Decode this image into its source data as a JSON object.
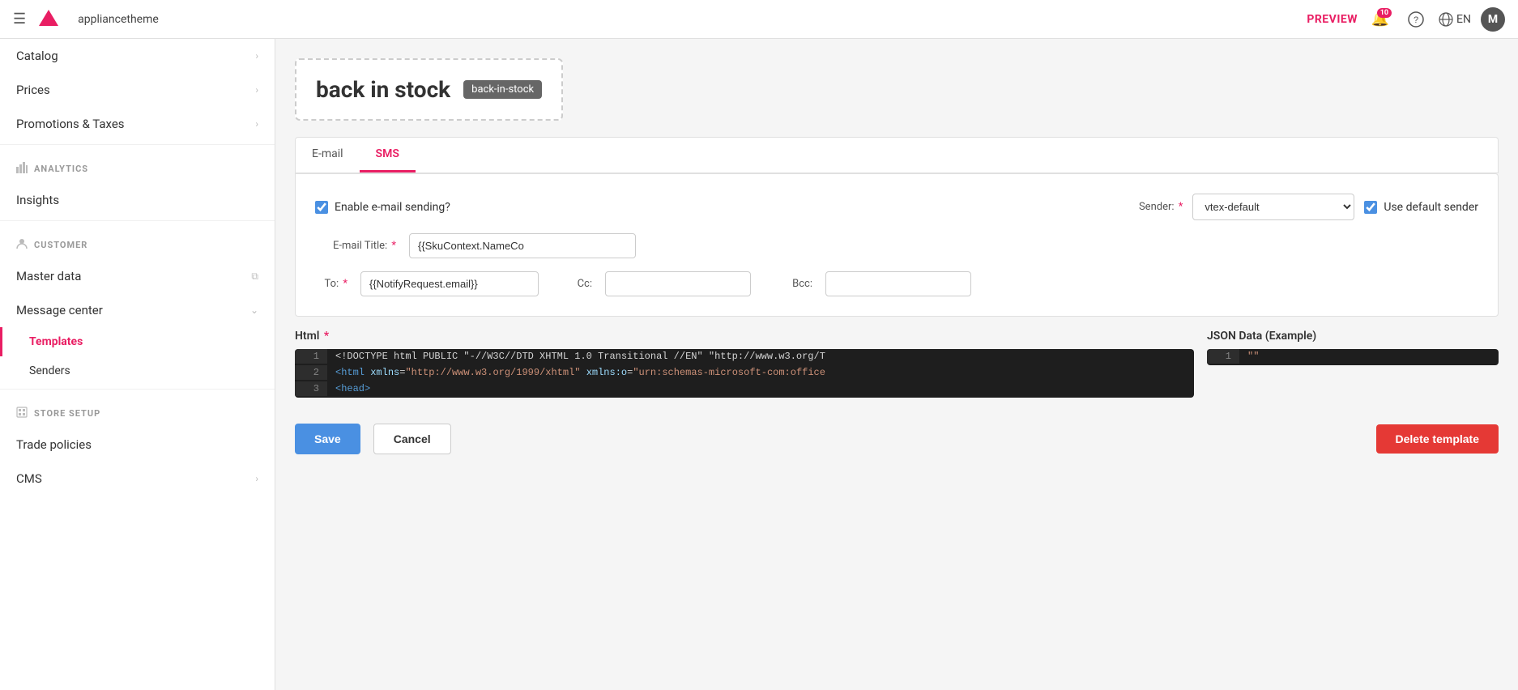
{
  "topbar": {
    "hamburger_icon": "☰",
    "logo_text": "▼",
    "app_name": "appliancetheme",
    "preview_label": "PREVIEW",
    "notifications_count": "10",
    "help_icon": "?",
    "globe_icon": "🌐",
    "lang": "EN",
    "avatar": "M"
  },
  "sidebar": {
    "catalog_label": "Catalog",
    "prices_label": "Prices",
    "promotions_taxes_label": "Promotions & Taxes",
    "analytics_label": "ANALYTICS",
    "insights_label": "Insights",
    "customer_label": "CUSTOMER",
    "master_data_label": "Master data",
    "message_center_label": "Message center",
    "templates_label": "Templates",
    "senders_label": "Senders",
    "store_setup_label": "STORE SETUP",
    "trade_policies_label": "Trade policies",
    "cms_label": "CMS"
  },
  "page": {
    "template_title": "back in stock",
    "template_slug": "back-in-stock",
    "tabs": [
      {
        "id": "email",
        "label": "E-mail"
      },
      {
        "id": "sms",
        "label": "SMS"
      }
    ],
    "active_tab": "sms",
    "enable_label": "Enable e-mail sending?",
    "sender_label": "Sender:",
    "sender_value": "vtex-default",
    "use_default_sender_label": "Use default sender",
    "email_title_label": "E-mail Title:",
    "email_title_value": "{{SkuContext.NameCo",
    "to_label": "To:",
    "to_value": "{{NotifyRequest.email}}",
    "cc_label": "Cc:",
    "cc_value": "",
    "bcc_label": "Bcc:",
    "bcc_value": "",
    "html_label": "Html",
    "json_data_label": "JSON Data (Example)",
    "code_lines": [
      {
        "num": "1",
        "content": "<!DOCTYPE html PUBLIC \"-//W3C//DTD XHTML 1.0 Transitional //EN\" \"http://www.w3.org/T"
      },
      {
        "num": "2",
        "content": "<html xmlns=\"http://www.w3.org/1999/xhtml\" xmlns:o=\"urn:schemas-microsoft-com:office"
      },
      {
        "num": "3",
        "content": "<head>"
      }
    ],
    "json_lines": [
      {
        "num": "1",
        "content": "\"\""
      }
    ],
    "save_label": "Save",
    "cancel_label": "Cancel",
    "delete_label": "Delete template"
  }
}
